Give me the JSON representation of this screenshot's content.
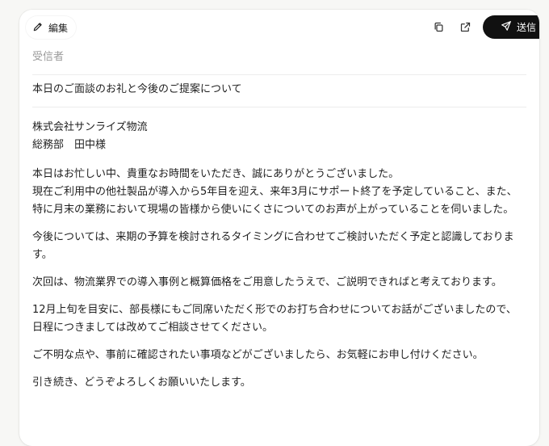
{
  "toolbar": {
    "edit_label": "編集",
    "send_label": "送信"
  },
  "recipient_placeholder": "受信者",
  "subject": "本日のご面談のお礼と今後のご提案について",
  "body": {
    "company": "株式会社サンライズ物流",
    "contact": "総務部　田中様",
    "p1": "本日はお忙しい中、貴重なお時間をいただき、誠にありがとうございました。",
    "p2": "現在ご利用中の他社製品が導入から5年目を迎え、来年3月にサポート終了を予定していること、また、特に月末の業務において現場の皆様から使いにくさについてのお声が上がっていることを伺いました。",
    "p3": "今後については、来期の予算を検討されるタイミングに合わせてご検討いただく予定と認識しております。",
    "p4": "次回は、物流業界での導入事例と概算価格をご用意したうえで、ご説明できればと考えております。",
    "p5": "12月上旬を目安に、部長様にもご同席いただく形でのお打ち合わせについてお話がございましたので、日程につきましては改めてご相談させてください。",
    "p6": "ご不明な点や、事前に確認されたい事項などがございましたら、お気軽にお申し付けください。",
    "p7": "引き続き、どうぞよろしくお願いいたします。"
  }
}
